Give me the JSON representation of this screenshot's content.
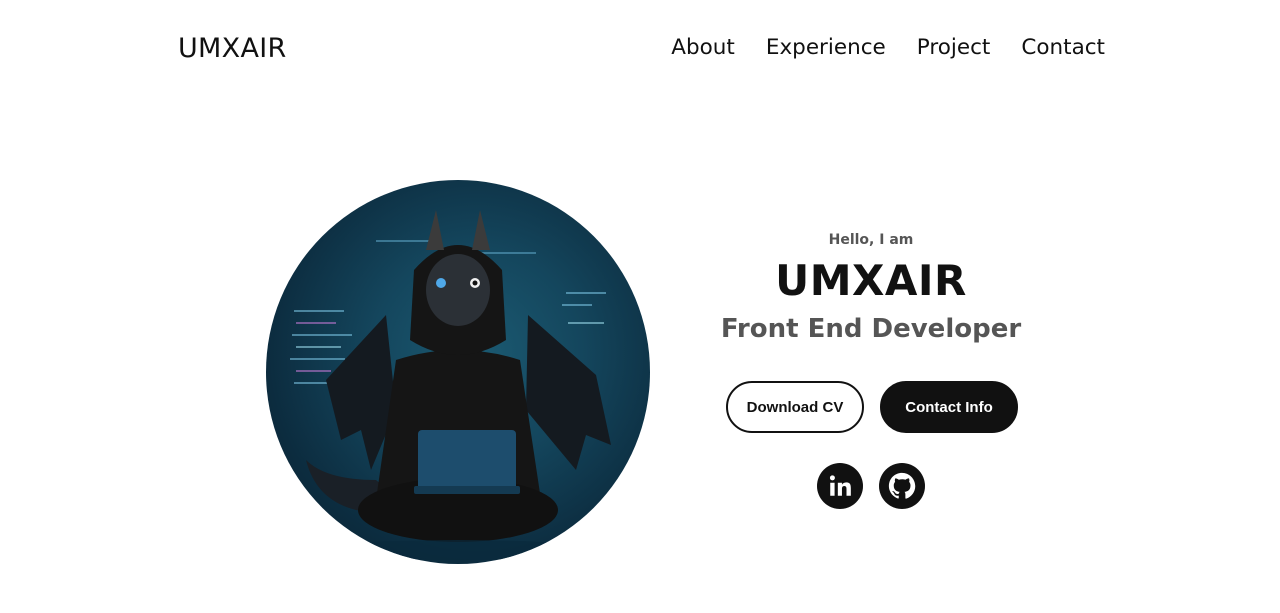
{
  "nav": {
    "logo": "UMXAIR",
    "links": [
      "About",
      "Experience",
      "Project",
      "Contact"
    ]
  },
  "profile": {
    "greeting": "Hello, I am",
    "name": "UMXAIR",
    "title": "Front End Developer",
    "image_alt": "profile-picture"
  },
  "buttons": {
    "download_cv": "Download CV",
    "contact_info": "Contact Info"
  },
  "socials": {
    "linkedin": "linkedin-icon",
    "github": "github-icon"
  },
  "colors": {
    "text": "#111111",
    "muted": "#555555",
    "background": "#ffffff",
    "image_bg": "#14465d"
  }
}
